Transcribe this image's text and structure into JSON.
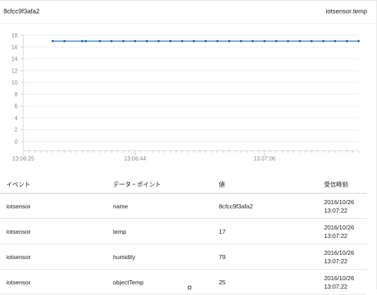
{
  "header": {
    "device_id": "8cfcc9f3afa2",
    "event_path": "iotsensor.temp"
  },
  "chart_data": {
    "type": "line",
    "title": "",
    "xlabel": "",
    "ylabel": "",
    "ylim": [
      0,
      18
    ],
    "y_ticks": [
      0,
      2,
      4,
      6,
      8,
      10,
      12,
      14,
      16,
      18
    ],
    "x_tick_labels": [
      "13:06:25",
      "13:06:44",
      "13:07:06"
    ],
    "x_tick_seconds": [
      0,
      19,
      41
    ],
    "xlim_seconds": [
      0,
      57
    ],
    "series": [
      {
        "color": "#1f6db3",
        "x_seconds": [
          5,
          7,
          10,
          10.6,
          13,
          15,
          17,
          19,
          21,
          23,
          25,
          27,
          29,
          31,
          33,
          35,
          37,
          39,
          41,
          43,
          45,
          47,
          49,
          51,
          53,
          55,
          57
        ],
        "values": [
          17,
          17,
          17,
          17,
          17,
          17,
          17,
          17,
          17,
          17,
          17,
          17,
          17,
          17,
          17,
          17,
          17,
          17,
          17,
          17,
          17,
          17,
          17,
          17,
          17,
          17,
          17
        ]
      }
    ],
    "grid": true
  },
  "table": {
    "columns": [
      "イベント",
      "データ・ポイント",
      "値",
      "受信時刻"
    ],
    "rows": [
      [
        "iotsensor",
        "name",
        "8cfcc9f3afa2",
        "2016/10/26\n13:07:22"
      ],
      [
        "iotsensor",
        "temp",
        "17",
        "2016/10/26\n13:07:22"
      ],
      [
        "iotsensor",
        "humidity",
        "79",
        "2016/10/26\n13:07:22"
      ],
      [
        "iotsensor",
        "objectTemp",
        "25",
        "2016/10/26\n13:07:22"
      ]
    ]
  }
}
